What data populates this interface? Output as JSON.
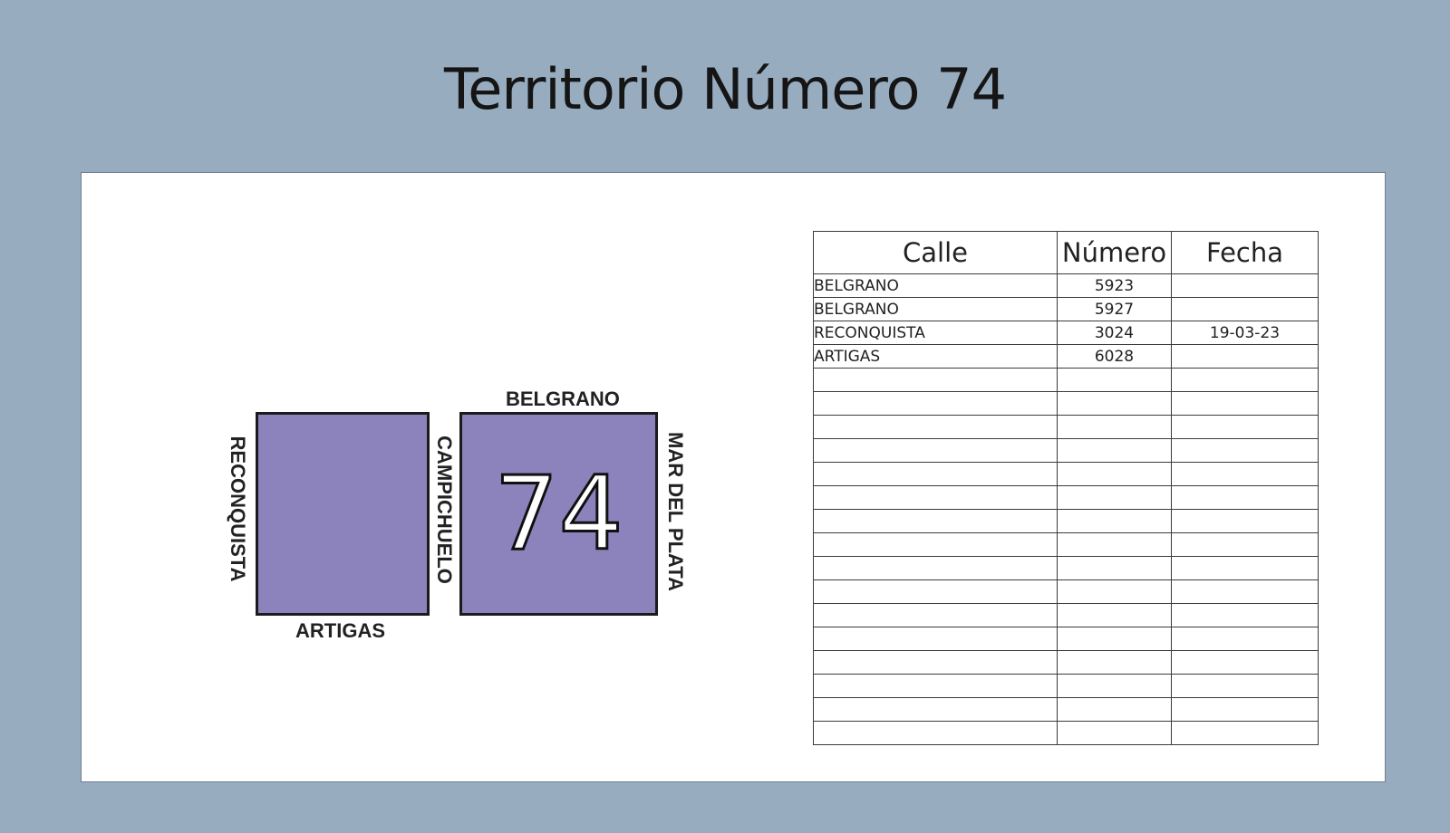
{
  "title": "Territorio Número 74",
  "map": {
    "territory_number": "74",
    "block_color": "#8c83bd",
    "streets": {
      "north": "BELGRANO",
      "south": "ARTIGAS",
      "west": "RECONQUISTA",
      "middle": "CAMPICHUELO",
      "east": "MAR DEL PLATA"
    }
  },
  "table": {
    "headers": [
      "Calle",
      "Número",
      "Fecha"
    ],
    "rows": [
      [
        "BELGRANO",
        "5923",
        ""
      ],
      [
        "BELGRANO",
        "5927",
        ""
      ],
      [
        "RECONQUISTA",
        "3024",
        "19-03-23"
      ],
      [
        "ARTIGAS",
        "6028",
        ""
      ],
      [
        "",
        "",
        ""
      ],
      [
        "",
        "",
        ""
      ],
      [
        "",
        "",
        ""
      ],
      [
        "",
        "",
        ""
      ],
      [
        "",
        "",
        ""
      ],
      [
        "",
        "",
        ""
      ],
      [
        "",
        "",
        ""
      ],
      [
        "",
        "",
        ""
      ],
      [
        "",
        "",
        ""
      ],
      [
        "",
        "",
        ""
      ],
      [
        "",
        "",
        ""
      ],
      [
        "",
        "",
        ""
      ],
      [
        "",
        "",
        ""
      ],
      [
        "",
        "",
        ""
      ],
      [
        "",
        "",
        ""
      ],
      [
        "",
        "",
        ""
      ]
    ]
  }
}
